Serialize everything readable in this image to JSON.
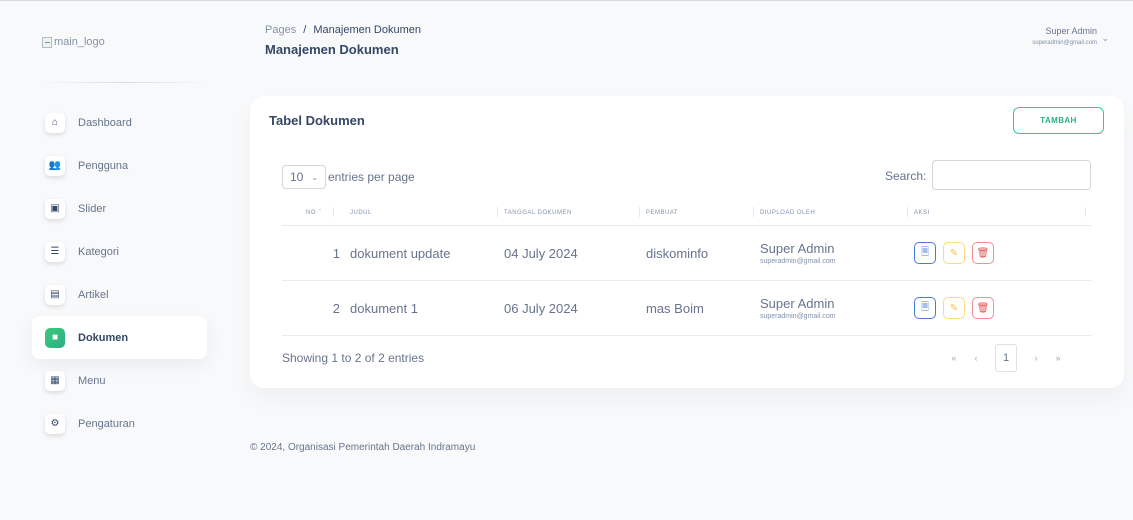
{
  "sidebar": {
    "logo_alt": "main_logo",
    "items": [
      {
        "label": "Dashboard",
        "icon": "home-icon",
        "glyph": "⌂",
        "active": false
      },
      {
        "label": "Pengguna",
        "icon": "users-icon",
        "glyph": "👥",
        "active": false
      },
      {
        "label": "Slider",
        "icon": "image-icon",
        "glyph": "▣",
        "active": false
      },
      {
        "label": "Kategori",
        "icon": "list-icon",
        "glyph": "☰",
        "active": false
      },
      {
        "label": "Artikel",
        "icon": "newspaper-icon",
        "glyph": "▤",
        "active": false
      },
      {
        "label": "Dokumen",
        "icon": "document-icon",
        "glyph": "■",
        "active": true
      },
      {
        "label": "Menu",
        "icon": "menu-icon",
        "glyph": "▦",
        "active": false
      },
      {
        "label": "Pengaturan",
        "icon": "gears-icon",
        "glyph": "⚙",
        "active": false
      }
    ]
  },
  "header": {
    "breadcrumb_root": "Pages",
    "breadcrumb_sep": "/",
    "breadcrumb_current": "Manajemen Dokumen",
    "title": "Manajemen Dokumen",
    "user_name": "Super Admin",
    "user_email": "superadmin@gmail.com"
  },
  "card": {
    "title": "Tabel Dokumen",
    "add_label": "TAMBAH",
    "entries_value": "10",
    "entries_label": "entries per page",
    "search_label": "Search:",
    "search_value": "",
    "columns": [
      "NO",
      "JUDUL",
      "TANGGAL DOKUMEN",
      "PEMBUAT",
      "DIUPLOAD OLEH",
      "AKSI"
    ],
    "rows": [
      {
        "no": "1",
        "judul": "dokument update",
        "tanggal": "04 July 2024",
        "pembuat": "diskominfo",
        "uploader": "Super Admin",
        "uploader_email": "superadmin@gmail.com"
      },
      {
        "no": "2",
        "judul": "dokument 1",
        "tanggal": "06 July 2024",
        "pembuat": "mas Boim",
        "uploader": "Super Admin",
        "uploader_email": "superadmin@gmail.com"
      }
    ],
    "info": "Showing 1 to 2 of 2 entries",
    "pager": {
      "first": "«",
      "prev": "‹",
      "page": "1",
      "next": "›",
      "last": "»"
    }
  },
  "footer": {
    "text": "© 2024, Organisasi Pemerintah Daerah Indramayu"
  },
  "colors": {
    "accent": "#2dce89",
    "text": "#344767",
    "muted": "#67748e",
    "view": "#4b79d8",
    "edit": "#f5c344",
    "delete": "#e05353"
  }
}
